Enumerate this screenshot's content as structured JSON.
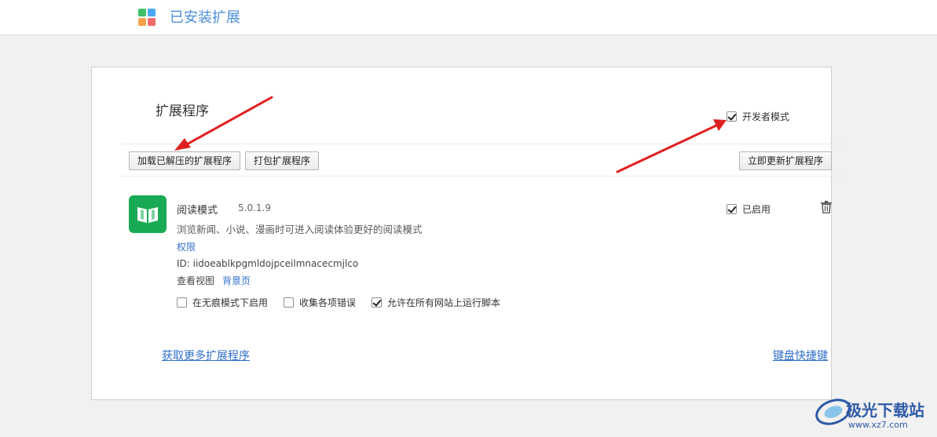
{
  "header": {
    "title": "已安装扩展",
    "logo_icon": "extensions-logo-icon"
  },
  "panel": {
    "section_title": "扩展程序",
    "developer_mode": {
      "label": "开发者模式",
      "checked": true
    },
    "toolbar": {
      "load_unpacked_label": "加载已解压的扩展程序",
      "pack_label": "打包扩展程序",
      "update_label": "立即更新扩展程序"
    },
    "extension": {
      "icon": "book-icon",
      "name": "阅读模式",
      "version": "5.0.1.9",
      "description": "浏览新闻、小说、漫画时可进入阅读体验更好的阅读模式",
      "permissions_link": "权限",
      "id_text": "ID: iidoeablkpgmldojpceilmnacecmjlco",
      "inspect_views_label": "查看视图",
      "background_page_link": "背景页",
      "enabled_label": "已启用",
      "enabled": true,
      "options": [
        {
          "label": "在无痕模式下启用",
          "checked": false
        },
        {
          "label": "收集各项错误",
          "checked": false
        },
        {
          "label": "允许在所有网站上运行脚本",
          "checked": true
        }
      ]
    },
    "footer": {
      "more_extensions_link": "获取更多扩展程序",
      "keyboard_shortcuts_link": "键盘快捷键"
    }
  },
  "watermark": {
    "brand": "极光下载站",
    "url": "www.xz7.com"
  },
  "colors": {
    "link": "#2f6fc9",
    "header_title": "#4a8fd9",
    "extension_icon_bg": "#1aaa55",
    "annotation_arrow": "#e02020"
  }
}
